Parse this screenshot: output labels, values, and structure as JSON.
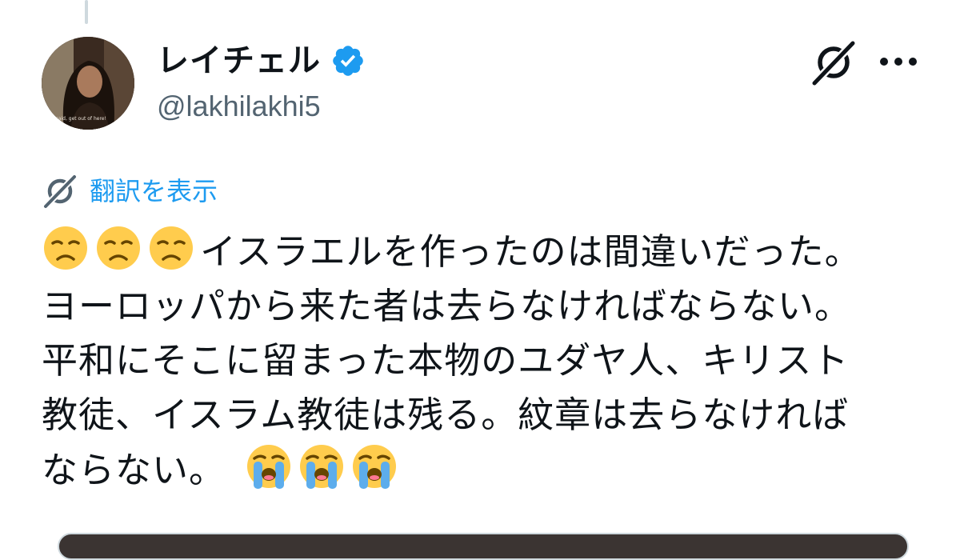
{
  "tweet": {
    "author": {
      "display_name": "レイチェル",
      "handle": "@lakhilakhi5",
      "verified": true,
      "avatar_caption": "I said, get out of here!"
    },
    "translate_label": "翻訳を表示",
    "text_lines": [
      "イスラエルを作ったのは間違いだった。",
      "ヨーロッパから来た者は去らなければならない。",
      "平和にそこに留まった本物のユダヤ人、キリスト",
      "教徒、イスラム教徒は残る。紋章は去らなければ",
      "ならない。"
    ],
    "leading_emojis": [
      "disappointed-face",
      "disappointed-face",
      "disappointed-face"
    ],
    "trailing_emojis": [
      "loudly-crying-face",
      "loudly-crying-face",
      "loudly-crying-face"
    ]
  },
  "icons": {
    "grok": "grok-icon",
    "more": "more-options-icon",
    "verified": "verified-badge-icon",
    "translate": "grok-translate-icon"
  },
  "colors": {
    "text": "#0f1419",
    "secondary": "#536471",
    "accent": "#1d9bf0",
    "emoji": "#ffcc4d"
  }
}
